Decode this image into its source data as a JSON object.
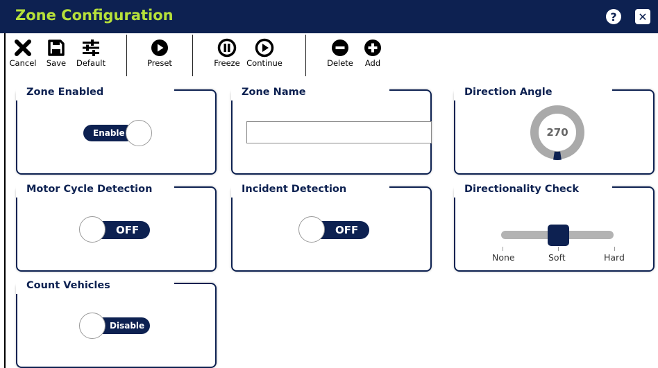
{
  "window": {
    "title": "Zone Configuration",
    "help_label": "?",
    "close_label": "✕"
  },
  "toolbar": {
    "cancel_label": "Cancel",
    "save_label": "Save",
    "default_label": "Default",
    "preset_label": "Preset",
    "freeze_label": "Freeze",
    "continue_label": "Continue",
    "delete_label": "Delete",
    "add_label": "Add"
  },
  "zone_enabled": {
    "title": "Zone Enabled",
    "toggle_label": "Enable",
    "state": "on"
  },
  "zone_name": {
    "title": "Zone Name",
    "value": "",
    "placeholder": ""
  },
  "direction_angle": {
    "title": "Direction Angle",
    "value": "270"
  },
  "motorcycle_detection": {
    "title": "Motor Cycle Detection",
    "toggle_label": "OFF",
    "state": "off"
  },
  "incident_detection": {
    "title": "Incident Detection",
    "toggle_label": "OFF",
    "state": "off"
  },
  "directionality_check": {
    "title": "Directionality Check",
    "options": [
      "None",
      "Soft",
      "Hard"
    ],
    "selected": "Soft"
  },
  "count_vehicles": {
    "title": "Count Vehicles",
    "toggle_label": "Disable",
    "state": "off"
  },
  "colors": {
    "navy": "#0d2151",
    "title_green": "#b6e03a",
    "track_gray": "#b3b3b3"
  }
}
